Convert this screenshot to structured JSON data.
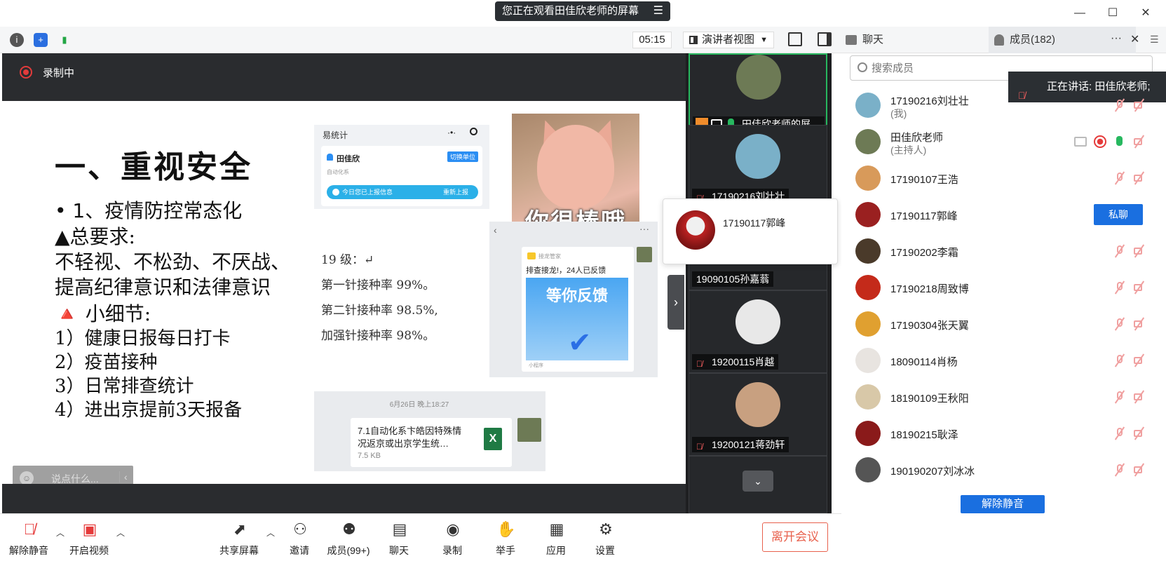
{
  "window": {
    "share_banner": "您正在观看田佳欣老师的屏幕",
    "minimize": "—",
    "maximize": "☐",
    "close": "✕"
  },
  "toolbar": {
    "timer": "05:15",
    "view_mode": "演讲者视图"
  },
  "panel_tabs": {
    "chat": "聊天",
    "members": "成员(182)"
  },
  "stage": {
    "recording": "录制中"
  },
  "slide": {
    "title": "一、重视安全",
    "bullet1": "• 1、疫情防控常态化",
    "lines": [
      "▲总要求:",
      "不轻视、不松劲、不厌战、",
      "提高纪律意识和法律意识",
      "🔺 小细节:",
      "1）健康日报每日打卡",
      "2）疫苗接种",
      "3）日常排查统计",
      "4）进出京提前3天报备"
    ],
    "mini_app": {
      "app_name": "易统计",
      "user": "田佳欣",
      "switch_label": "切换单位",
      "dept": "自动化系",
      "reported": "今日您已上报信息",
      "rereport": "重新上报"
    },
    "sticker_caption": "你很棒哦",
    "group_card": {
      "source": "接龙管家",
      "title": "排查接龙!，24人已反馈",
      "image_text": "等你反馈",
      "footer": "小程序"
    },
    "rates": [
      "19 级：↵",
      "第一针接种率 99%。",
      "第二针接种率 98.5%,",
      "加强针接种率 98%。"
    ],
    "file_msg": {
      "time": "6月26日 晚上18:27",
      "name": "7.1自动化系卞皓因特殊情况返京或出京学生统…",
      "size": "7.5 KB",
      "type": "X"
    },
    "chat_input_placeholder": "说点什么..."
  },
  "video_tiles": [
    {
      "label": "田佳欣老师的屏…",
      "color": "#6d7a55"
    },
    {
      "label": "17190216刘壮壮",
      "color": "#7ab0c8"
    },
    {
      "label": "19090105孙嘉蓊",
      "color": "#444"
    },
    {
      "label": "19200115肖越",
      "color": "#e8e8e8"
    },
    {
      "label": "19200121蒋劲轩",
      "color": "#c8a080"
    }
  ],
  "hover_card": {
    "name": "17190117郭峰"
  },
  "members": {
    "search_placeholder": "搜索成员",
    "speaking": "正在讲话: 田佳欣老师;",
    "private_chat": "私聊",
    "unmute_all": "解除静音",
    "list": [
      {
        "name": "17190216刘壮壮",
        "sub": "(我)",
        "color": "#7ab0c8"
      },
      {
        "name": "田佳欣老师",
        "sub": "(主持人)",
        "color": "#6d7a55"
      },
      {
        "name": "17190107王浩",
        "sub": "",
        "color": "#d89a5a"
      },
      {
        "name": "17190117郭峰",
        "sub": "",
        "color": "#9a2020"
      },
      {
        "name": "17190202李霜",
        "sub": "",
        "color": "#4a3a2a"
      },
      {
        "name": "17190218周致博",
        "sub": "",
        "color": "#c42a1a"
      },
      {
        "name": "17190304张天翼",
        "sub": "",
        "color": "#e0a030"
      },
      {
        "name": "18090114肖杨",
        "sub": "",
        "color": "#e8e4e0"
      },
      {
        "name": "18190109王秋阳",
        "sub": "",
        "color": "#d8c8a8"
      },
      {
        "name": "18190215耿泽",
        "sub": "",
        "color": "#8a1a1a"
      },
      {
        "name": "190190207刘冰冰",
        "sub": "",
        "color": "#555"
      }
    ]
  },
  "controls": {
    "unmute": "解除静音",
    "start_video": "开启视频",
    "share_screen": "共享屏幕",
    "invite": "邀请",
    "members": "成员(99+)",
    "chat": "聊天",
    "record": "录制",
    "raise_hand": "举手",
    "apps": "应用",
    "settings": "设置",
    "leave": "离开会议"
  }
}
